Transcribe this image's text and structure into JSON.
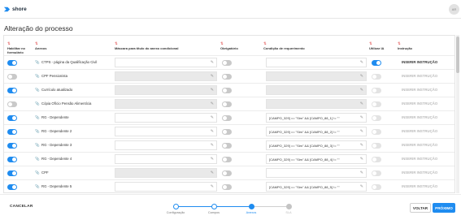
{
  "app": {
    "brand": "shore",
    "avatar_initials": "AR"
  },
  "page": {
    "title": "Alteração do processo"
  },
  "table": {
    "columns": [
      {
        "label": "Habilitar no formulário",
        "icon": "sort-icon"
      },
      {
        "label": "Anexos",
        "icon": "sort-icon"
      },
      {
        "label": "Máscara para título do anexo condicional",
        "icon": "sort-icon"
      },
      {
        "label": "Obrigatório",
        "icon": "sort-icon"
      },
      {
        "label": "Condição de requerimento",
        "icon": "sort-icon"
      },
      {
        "label": "Utilizar IA",
        "icon": "sort-icon"
      },
      {
        "label": "Instrução",
        "icon": "sort-icon"
      }
    ],
    "rows": [
      {
        "enabled": true,
        "anexo": "CTPS - página da Qualificação Civil",
        "mask": "",
        "mask_disabled": false,
        "required": false,
        "condition": "",
        "condition_disabled": false,
        "ai": true,
        "instruction": "INSERIR INSTRUÇÃO",
        "instruction_active": true
      },
      {
        "enabled": false,
        "anexo": "CPF Pensionista",
        "mask": "",
        "mask_disabled": true,
        "required": false,
        "condition": "",
        "condition_disabled": true,
        "ai": false,
        "instruction": "INSERIR INSTRUÇÃO",
        "instruction_active": false
      },
      {
        "enabled": true,
        "anexo": "Currículo atualizado",
        "mask": "",
        "mask_disabled": true,
        "required": false,
        "condition": "",
        "condition_disabled": true,
        "ai": false,
        "instruction": "INSERIR INSTRUÇÃO",
        "instruction_active": false
      },
      {
        "enabled": false,
        "anexo": "Cópia Ofício Pensão Alimentícia",
        "mask": "",
        "mask_disabled": true,
        "required": false,
        "condition": "",
        "condition_disabled": true,
        "ai": false,
        "instruction": "INSERIR INSTRUÇÃO",
        "instruction_active": false
      },
      {
        "enabled": true,
        "anexo": "RG - Dependente",
        "mask": "",
        "mask_disabled": false,
        "required": false,
        "condition": "[CAMPO_329] == \"Sim\" && [CAMPO_88_1] != \"\"",
        "condition_disabled": false,
        "ai": false,
        "instruction": "INSERIR INSTRUÇÃO",
        "instruction_active": false
      },
      {
        "enabled": true,
        "anexo": "RG - Dependente 2",
        "mask": "",
        "mask_disabled": false,
        "required": false,
        "condition": "[CAMPO_329] == \"Sim\" && [CAMPO_88_2] != \"\"",
        "condition_disabled": false,
        "ai": false,
        "instruction": "INSERIR INSTRUÇÃO",
        "instruction_active": false
      },
      {
        "enabled": true,
        "anexo": "RG - Dependente 3",
        "mask": "",
        "mask_disabled": false,
        "required": false,
        "condition": "[CAMPO_329] == \"Sim\" && [CAMPO_88_3] != \"\"",
        "condition_disabled": false,
        "ai": false,
        "instruction": "INSERIR INSTRUÇÃO",
        "instruction_active": false
      },
      {
        "enabled": true,
        "anexo": "RG - Dependente 4",
        "mask": "",
        "mask_disabled": false,
        "required": false,
        "condition": "[CAMPO_329] == \"Sim\" && [CAMPO_88_4] != \"\"",
        "condition_disabled": false,
        "ai": false,
        "instruction": "INSERIR INSTRUÇÃO",
        "instruction_active": false
      },
      {
        "enabled": true,
        "anexo": "CPF",
        "mask": "",
        "mask_disabled": true,
        "required": false,
        "condition": "",
        "condition_disabled": false,
        "ai": false,
        "instruction": "INSERIR INSTRUÇÃO",
        "instruction_active": false
      },
      {
        "enabled": true,
        "anexo": "RG - Dependente 5",
        "mask": "",
        "mask_disabled": false,
        "required": false,
        "condition": "[CAMPO_329] == \"Sim\" && [CAMPO_88_5] != \"\"",
        "condition_disabled": false,
        "ai": false,
        "instruction": "INSERIR INSTRUÇÃO",
        "instruction_active": false
      }
    ]
  },
  "footer": {
    "cancel_label": "CANCELAR",
    "back_label": "VOLTAR",
    "next_label": "PRÓXIMO",
    "steps": [
      {
        "label": "Configuração",
        "state": "done"
      },
      {
        "label": "Campos",
        "state": "done"
      },
      {
        "label": "Anexos",
        "state": "current"
      },
      {
        "label": "SLA",
        "state": "pending"
      }
    ]
  },
  "colors": {
    "accent": "#1f8cf0",
    "sort_icon": "#e25555",
    "disabled_field": "#e9e9e9"
  },
  "icons": {
    "brand": "shore-logo-icon",
    "attachment": "paperclip-icon",
    "edit": "pencil-icon"
  }
}
